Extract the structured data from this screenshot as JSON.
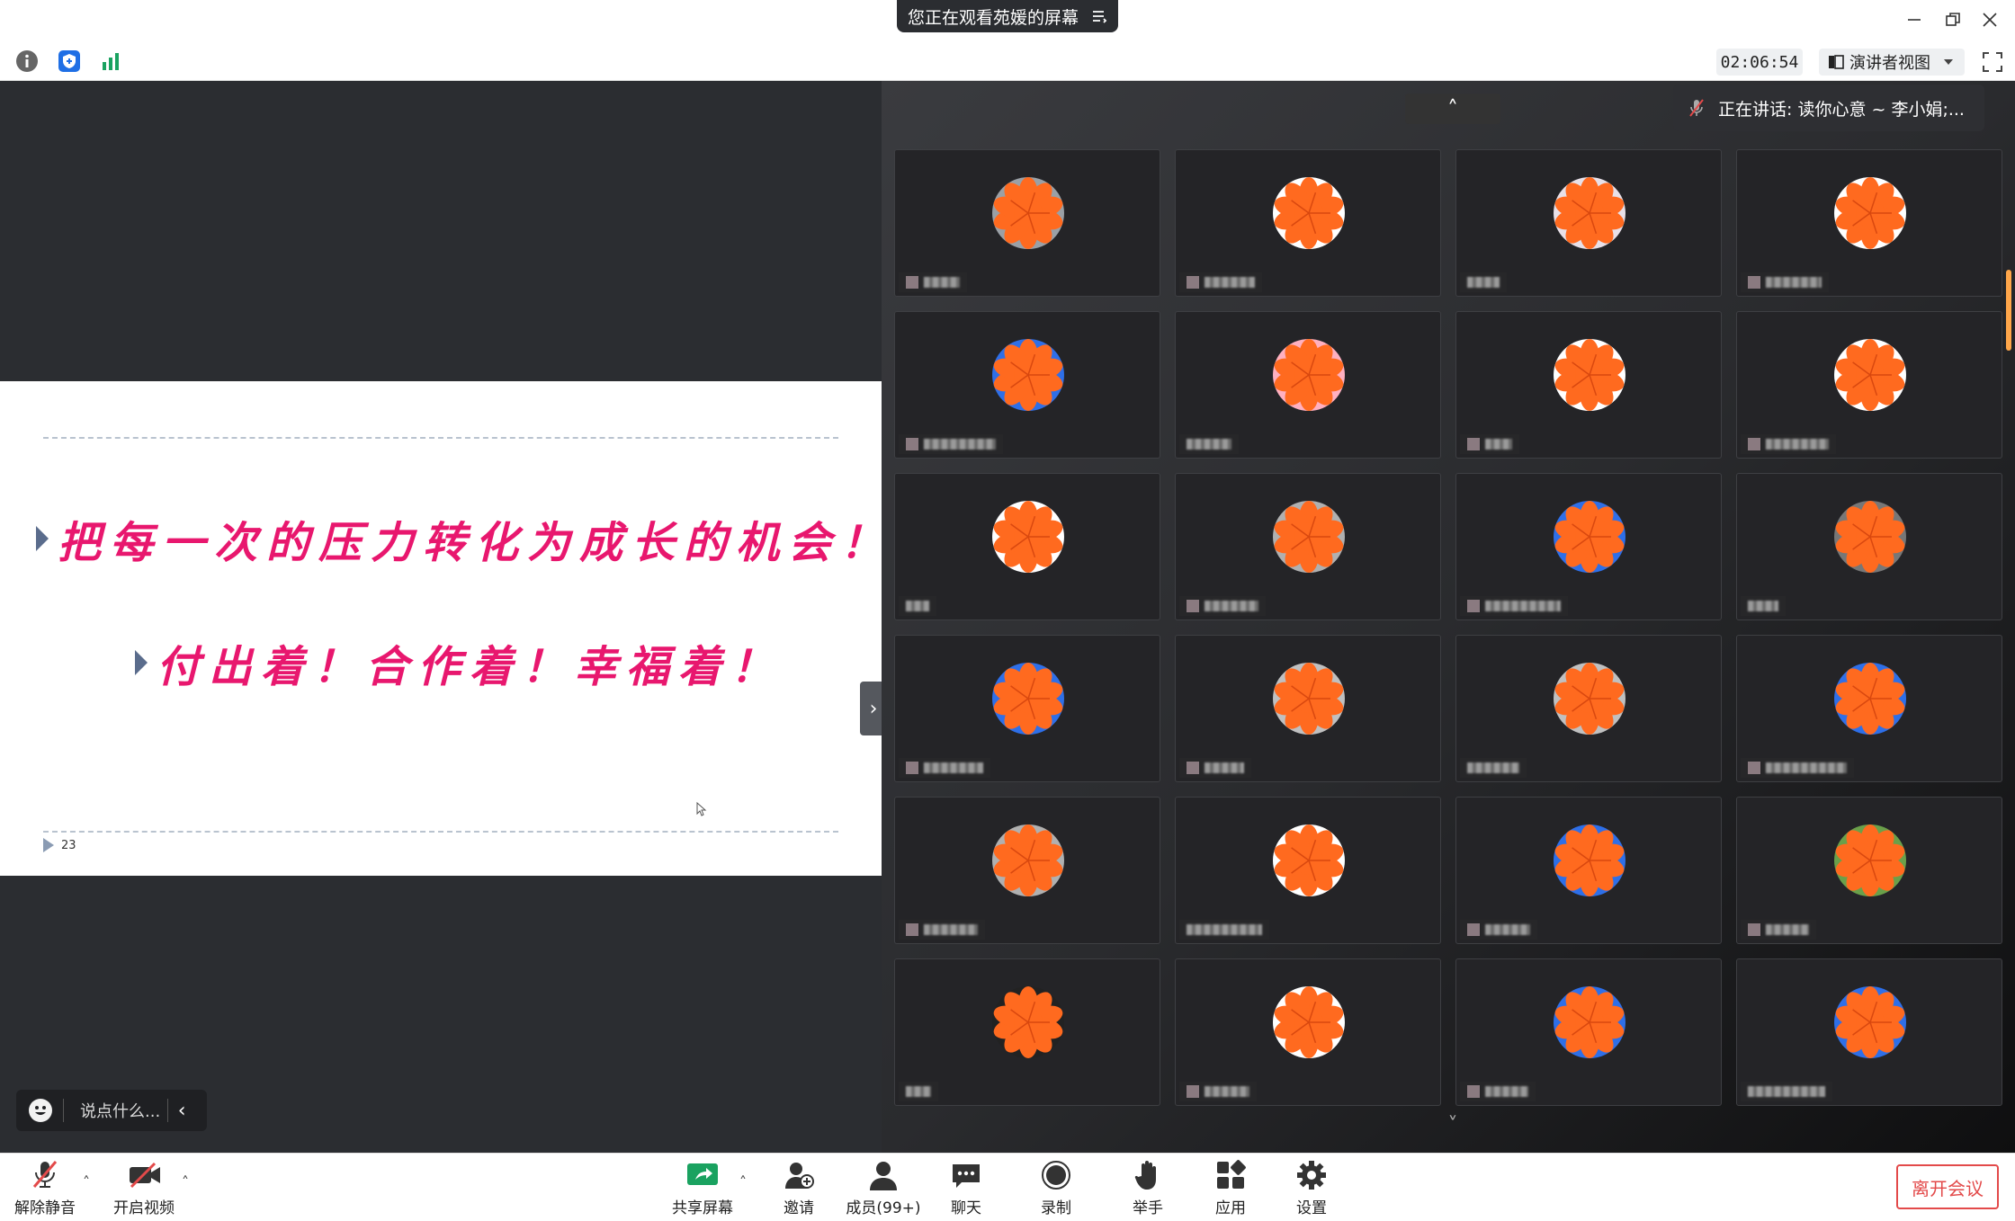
{
  "titlebar": {
    "banner_text": "您正在观看苑媛的屏幕"
  },
  "toolbar": {
    "timer": "02:06:54",
    "view_label": "演讲者视图"
  },
  "slide": {
    "line1": "把每一次的压力转化为成长的机会！",
    "line2": "付出着！合作着！幸福着！",
    "page_number": "23"
  },
  "chat": {
    "placeholder": "说点什么..."
  },
  "gallery": {
    "speaking_text": "正在讲话: 读你心意 ~ 李小娟;..."
  },
  "bottombar": {
    "unmute": "解除静音",
    "video": "开启视频",
    "share": "共享屏幕",
    "invite": "邀请",
    "members": "成员(99+)",
    "chat": "聊天",
    "record": "录制",
    "raise_hand": "举手",
    "apps": "应用",
    "settings": "设置",
    "leave": "离开会议"
  },
  "colors": {
    "slide_text": "#e8176e",
    "accent_orange": "#ff6a1f",
    "leave_red": "#e34a4a",
    "share_green": "#1aa260"
  },
  "avatars": [
    {
      "ring": "#9aa0a6"
    },
    {
      "ring": "#ffffff"
    },
    {
      "ring": "#e8e0e8"
    },
    {
      "ring": "#ffffff"
    },
    {
      "ring": "#2e6fe8"
    },
    {
      "ring": "#ffb0c0"
    },
    {
      "ring": "#ffffff"
    },
    {
      "ring": "#ffffff"
    },
    {
      "ring": "#ffffff"
    },
    {
      "ring": "#b0b0b0"
    },
    {
      "ring": "#2e6fe8"
    },
    {
      "ring": "#777777"
    },
    {
      "ring": "#2e6fe8"
    },
    {
      "ring": "#c0c0c0"
    },
    {
      "ring": "#c0c0c0"
    },
    {
      "ring": "#2e6fe8"
    },
    {
      "ring": "#b0b0b0"
    },
    {
      "ring": "#ffffff"
    },
    {
      "ring": "#2e6fe8"
    },
    {
      "ring": "#6aa04a"
    },
    {
      "ring": "#222222"
    },
    {
      "ring": "#ffffff"
    },
    {
      "ring": "#2e6fe8"
    },
    {
      "ring": "#2e6fe8"
    }
  ]
}
